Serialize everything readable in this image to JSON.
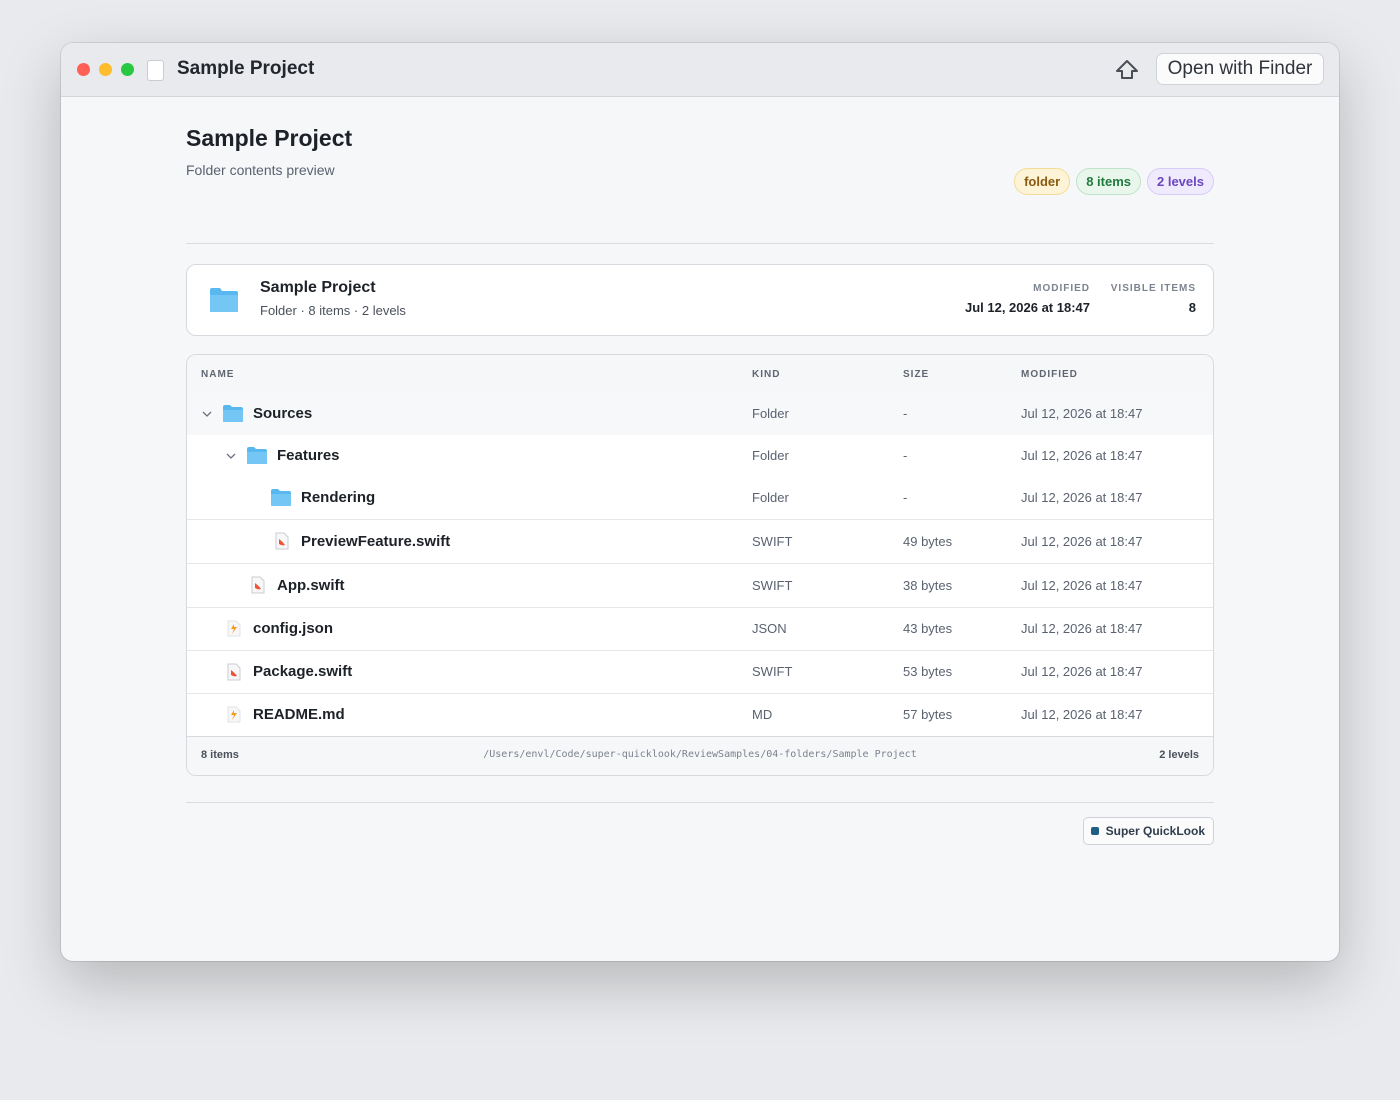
{
  "window": {
    "title": "Sample Project",
    "open_button": "Open with Finder",
    "share_icon": "share-icon"
  },
  "header": {
    "title": "Sample Project",
    "subtitle": "Folder contents preview",
    "badges": [
      "folder",
      "8 items",
      "2 levels"
    ]
  },
  "summary": {
    "name": "Sample Project",
    "meta": "Folder · 8 items · 2 levels",
    "modified_label": "MODIFIED",
    "modified_value": "Jul 12, 2026 at 18:47",
    "visible_label": "VISIBLE ITEMS",
    "visible_value": "8"
  },
  "table": {
    "columns": [
      "NAME",
      "KIND",
      "SIZE",
      "MODIFIED"
    ],
    "rows": [
      {
        "name": "Sources",
        "kind": "Folder",
        "size": "-",
        "modified": "Jul 12, 2026 at 18:47",
        "icon": "folder-icon",
        "expanded": true,
        "depth": 0
      },
      {
        "name": "Features",
        "kind": "Folder",
        "size": "-",
        "modified": "Jul 12, 2026 at 18:47",
        "icon": "folder-icon",
        "expanded": true,
        "depth": 1
      },
      {
        "name": "Rendering",
        "kind": "Folder",
        "size": "-",
        "modified": "Jul 12, 2026 at 18:47",
        "icon": "folder-icon",
        "depth": 2
      },
      {
        "name": "PreviewFeature.swift",
        "kind": "SWIFT",
        "size": "49 bytes",
        "modified": "Jul 12, 2026 at 18:47",
        "icon": "swift-file-icon",
        "depth": 2
      },
      {
        "name": "App.swift",
        "kind": "SWIFT",
        "size": "38 bytes",
        "modified": "Jul 12, 2026 at 18:47",
        "icon": "swift-file-icon",
        "depth": 1
      },
      {
        "name": "config.json",
        "kind": "JSON",
        "size": "43 bytes",
        "modified": "Jul 12, 2026 at 18:47",
        "icon": "json-file-icon",
        "depth": 0
      },
      {
        "name": "Package.swift",
        "kind": "SWIFT",
        "size": "53 bytes",
        "modified": "Jul 12, 2026 at 18:47",
        "icon": "swift-file-icon",
        "depth": 0
      },
      {
        "name": "README.md",
        "kind": "MD",
        "size": "57 bytes",
        "modified": "Jul 12, 2026 at 18:47",
        "icon": "markdown-file-icon",
        "depth": 0
      }
    ],
    "footer": {
      "count": "8 items",
      "path": "/Users/envl/Code/super-quicklook/ReviewSamples/04-folders/Sample Project",
      "levels": "2 levels"
    }
  },
  "brand": {
    "label": "Super QuickLook",
    "color": "#1f5f86"
  },
  "colors": {
    "folder": "#5ab8f0",
    "swift": "#f05138",
    "badge_folder": "#fdf3d7",
    "badge_items": "#e8f6ec",
    "badge_levels": "#f0eafd"
  }
}
